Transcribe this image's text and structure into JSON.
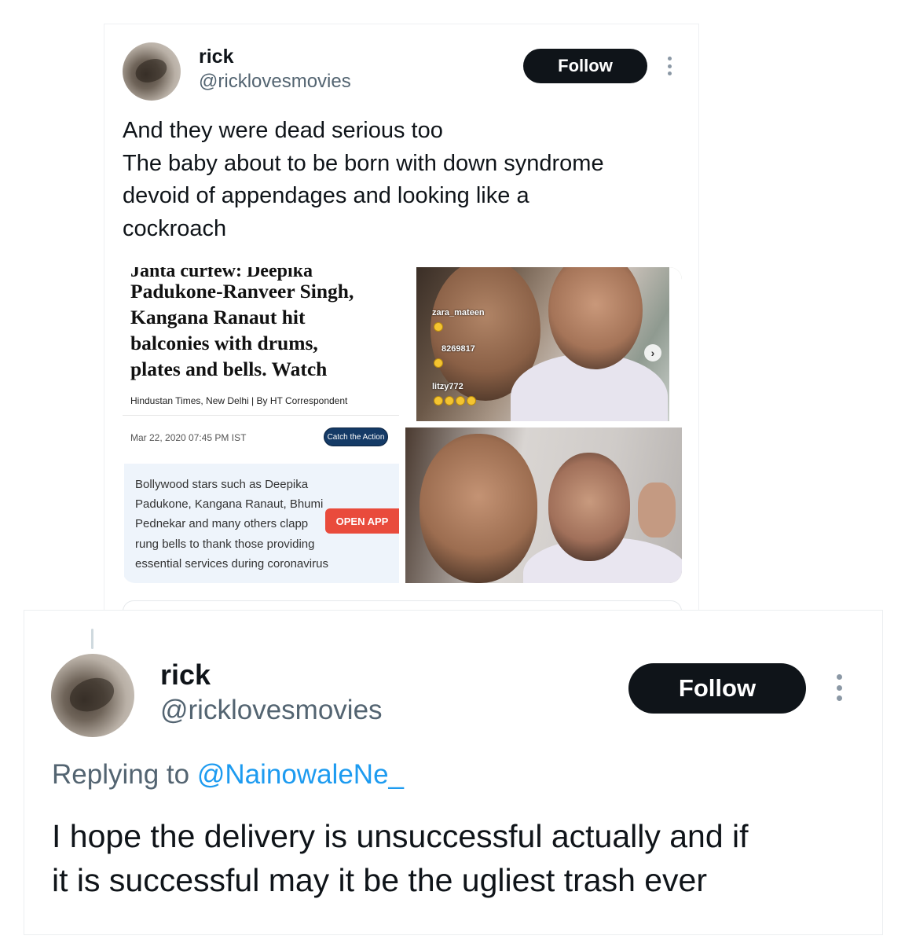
{
  "top_tweet": {
    "display_name": "rick",
    "handle": "@ricklovesmovies",
    "follow_label": "Follow",
    "text_lines": [
      "And they were dead serious too",
      "The baby about to be born with down syndrome",
      "devoid of appendages and looking like a",
      "cockroach"
    ],
    "article": {
      "cut_headline": "Janta curfew: Deepika",
      "headline_lines": [
        "Padukone-Ranveer Singh,",
        "Kangana Ranaut hit",
        "balconies with drums,",
        "plates and bells. Watch"
      ],
      "source": "Hindustan Times, New Delhi | By HT Correspondent",
      "date": "Mar 22, 2020 07:45 PM IST",
      "catch_label": "Catch the Action",
      "summary_lines": [
        "Bollywood stars such as Deepika",
        "Padukone, Kangana Ranaut, Bhumi",
        "Pednekar and many others clapp",
        "rung bells to thank those providing",
        "essential services during coronavirus"
      ],
      "open_app_label": "OPEN APP"
    },
    "live_comments": [
      "zara_mateen",
      "8269817",
      "litzy772"
    ]
  },
  "reply_tweet": {
    "display_name": "rick",
    "handle": "@ricklovesmovies",
    "follow_label": "Follow",
    "replying_prefix": "Replying to ",
    "replying_handle": "@NainowaleNe_",
    "text_lines": [
      "I hope the delivery is unsuccessful actually and if",
      "it is successful may it be the ugliest trash ever"
    ]
  },
  "colors": {
    "text": "#0f1419",
    "secondary": "#536471",
    "link": "#1d9bf0",
    "follow_bg": "#0f1419",
    "open_app": "#e94b3c"
  }
}
